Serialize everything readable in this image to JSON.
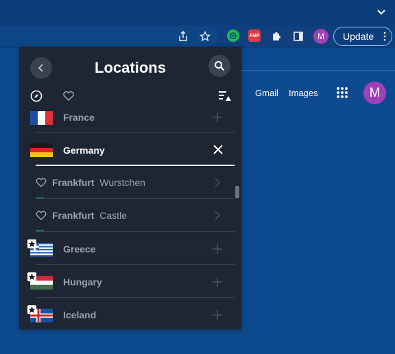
{
  "browser": {
    "update_label": "Update",
    "profile_initial": "M",
    "abp_label": "ABP"
  },
  "page": {
    "gmail_label": "Gmail",
    "images_label": "Images",
    "avatar_initial": "M"
  },
  "popup": {
    "title": "Locations",
    "countries": [
      {
        "name": "France",
        "flag": "fr",
        "starred": false,
        "action": "plus-icon"
      },
      {
        "name": "Germany",
        "flag": "de",
        "starred": false,
        "expanded": true,
        "action": "close-icon"
      },
      {
        "name": "Greece",
        "flag": "gr",
        "starred": true,
        "action": "plus-icon"
      },
      {
        "name": "Hungary",
        "flag": "hu",
        "starred": true,
        "action": "plus-icon"
      },
      {
        "name": "Iceland",
        "flag": "is",
        "starred": true,
        "action": "plus-icon"
      }
    ],
    "cities": [
      {
        "city": "Frankfurt",
        "server": "Wurstchen"
      },
      {
        "city": "Frankfurt",
        "server": "Castle"
      }
    ]
  },
  "colors": {
    "page_bg": "#0e4a8f",
    "popup_bg": "#1e2533",
    "accent_green": "#2fbf6d",
    "avatar": "#a13fb8"
  }
}
